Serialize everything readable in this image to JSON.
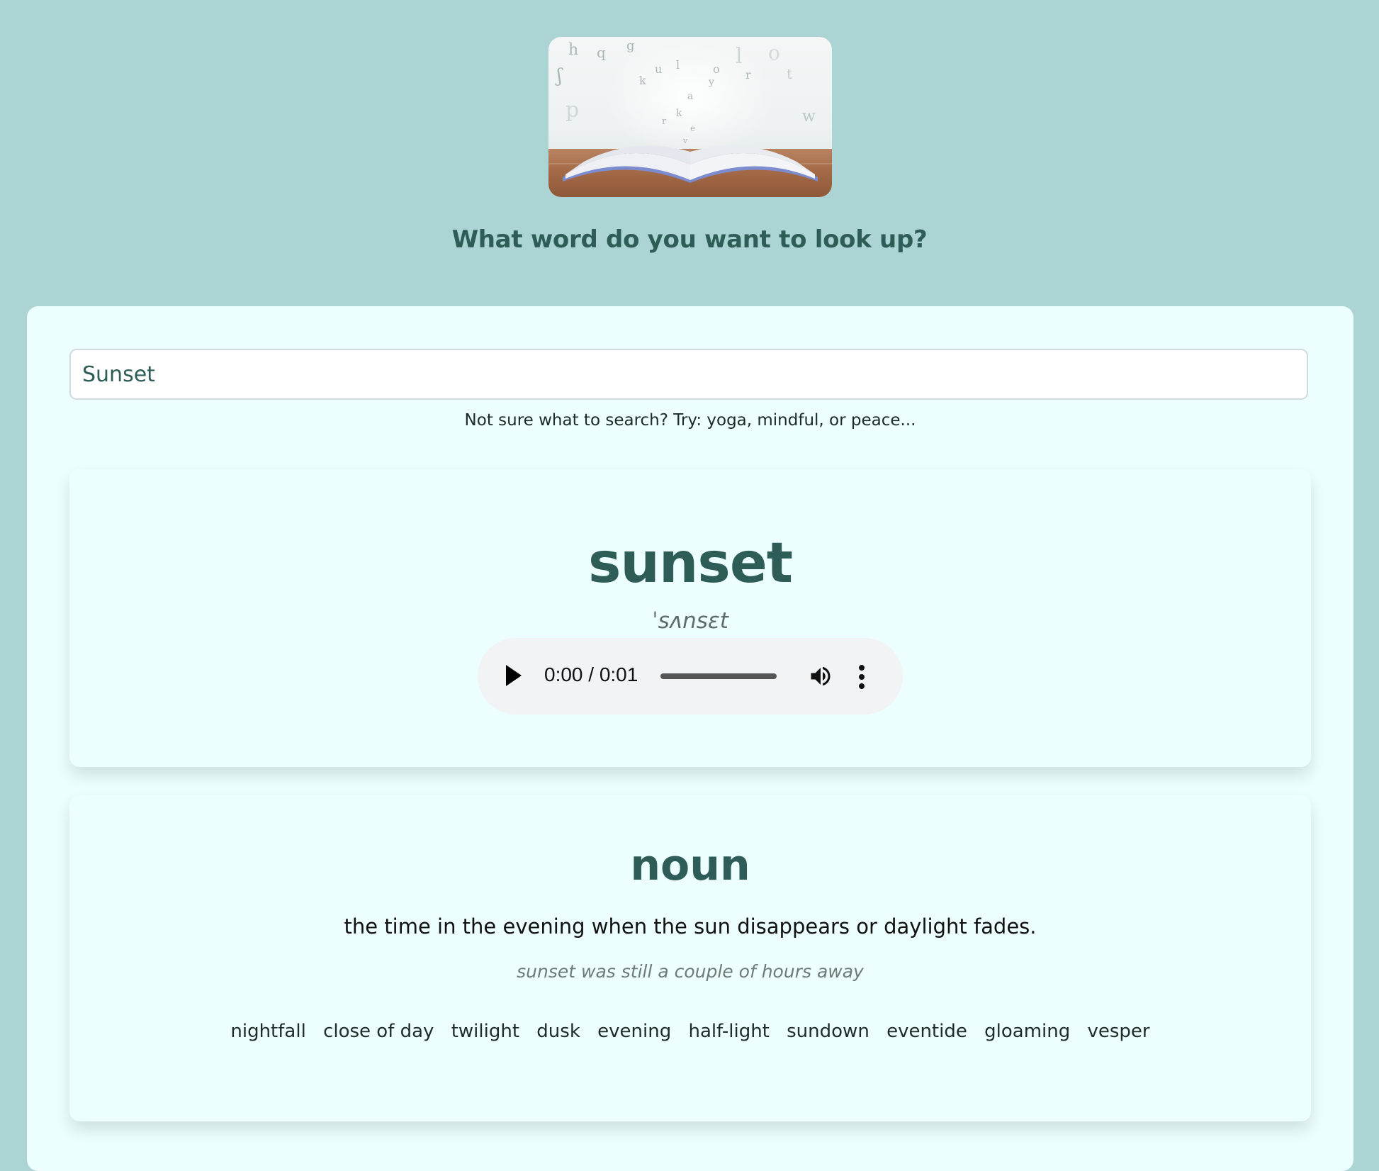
{
  "header": {
    "title": "What word do you want to look up?"
  },
  "search": {
    "value": "Sunset",
    "hint": "Not sure what to search? Try: yoga, mindful, or peace..."
  },
  "word_card": {
    "word": "sunset",
    "phonetic": "ˈsʌnsɛt",
    "audio": {
      "time": "0:00 / 0:01"
    }
  },
  "meaning": {
    "part_of_speech": "noun",
    "definition": "the time in the evening when the sun disappears or daylight fades.",
    "example": "sunset was still a couple of hours away",
    "synonyms": [
      "nightfall",
      "close of day",
      "twilight",
      "dusk",
      "evening",
      "half-light",
      "sundown",
      "eventide",
      "gloaming",
      "vesper"
    ]
  },
  "colors": {
    "page_background": "#acd4d4",
    "panel_background": "#ecfffe",
    "accent": "#2e5d57"
  }
}
